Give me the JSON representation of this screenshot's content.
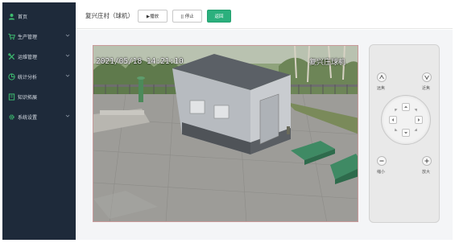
{
  "sidebar": {
    "items": [
      {
        "label": "首页",
        "icon": "user-icon",
        "has_children": false
      },
      {
        "label": "生产管理",
        "icon": "cart-icon",
        "has_children": true
      },
      {
        "label": "运维管理",
        "icon": "tools-icon",
        "has_children": true
      },
      {
        "label": "统计分析",
        "icon": "chart-icon",
        "has_children": true
      },
      {
        "label": "知识拓展",
        "icon": "book-icon",
        "has_children": false
      },
      {
        "label": "系统设置",
        "icon": "gear-icon",
        "has_children": true
      }
    ]
  },
  "header": {
    "camera_title": "复兴庄村（球机）",
    "play_label": "▶播放",
    "stop_label": "|| 停止",
    "back_label": "返回"
  },
  "video": {
    "timestamp": "2021/05/18 14:21:10",
    "overlay_name": "复兴庄球机"
  },
  "ptz": {
    "far_focus_label": "远焦",
    "near_focus_label": "近焦",
    "zoom_out_label": "缩小",
    "zoom_in_label": "放大"
  },
  "colors": {
    "sidebar_bg": "#1e2a3a",
    "accent": "#2bb07d",
    "icon_green": "#3dbb6f"
  }
}
